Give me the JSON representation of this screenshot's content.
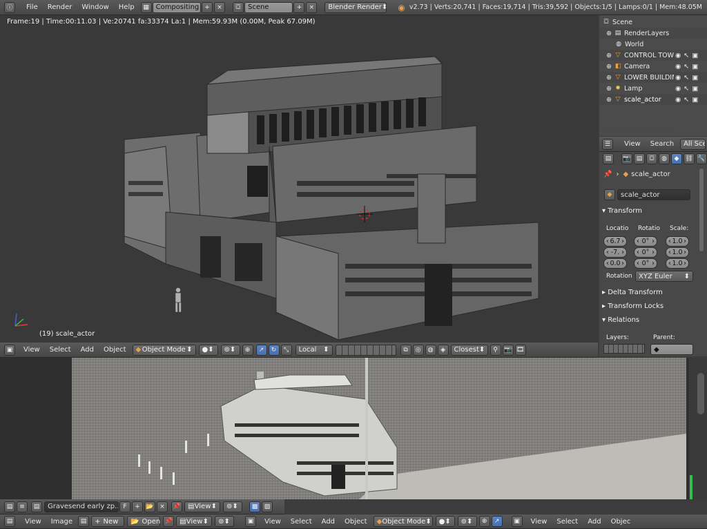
{
  "top_bar": {
    "menus": [
      "File",
      "Render",
      "Window",
      "Help"
    ],
    "screen_layout": "Compositing",
    "scene": "Scene",
    "render_engine": "Blender Render",
    "stats": "v2.73 | Verts:20,741 | Faces:19,714 | Tris:39,592 | Objects:1/5 | Lamps:0/1 | Mem:48.05M"
  },
  "viewport": {
    "info": "Frame:19 | Time:00:11.03 | Ve:20741 fa:33374 La:1 | Mem:59.93M (0.00M, Peak 67.09M)",
    "active_object": "(19) scale_actor",
    "header": {
      "menus": [
        "View",
        "Select",
        "Add",
        "Object"
      ],
      "mode": "Object Mode",
      "orientation": "Local",
      "snap_target": "Closest"
    }
  },
  "outliner": {
    "items": [
      {
        "name": "Scene",
        "icon": "scene-icon"
      },
      {
        "name": "RenderLayers",
        "icon": "renderlayers-icon"
      },
      {
        "name": "World",
        "icon": "world-icon"
      },
      {
        "name": "CONTROL TOWER",
        "icon": "mesh-icon"
      },
      {
        "name": "Camera",
        "icon": "camera-icon"
      },
      {
        "name": "LOWER BUILDING",
        "icon": "mesh-icon"
      },
      {
        "name": "Lamp",
        "icon": "lamp-icon"
      },
      {
        "name": "scale_actor",
        "icon": "mesh-icon"
      }
    ],
    "header": {
      "menus": [
        "View",
        "Search"
      ],
      "filter": "All Scenes"
    }
  },
  "properties": {
    "breadcrumb": "scale_actor",
    "object_name": "scale_actor",
    "transform_panel": "Transform",
    "location_label": "Locatio",
    "rotation_label": "Rotatio",
    "scale_label": "Scale:",
    "location": [
      "6.7",
      "-7.",
      "0.0"
    ],
    "rotation": [
      "0°",
      "0°",
      "0°"
    ],
    "scale": [
      "1.0",
      "1.0",
      "1.0"
    ],
    "rotation_mode_label": "Rotation",
    "rotation_mode": "XYZ Euler",
    "delta_transform": "Delta Transform",
    "transform_locks": "Transform Locks",
    "relations": "Relations",
    "layers_label": "Layers:",
    "parent_label": "Parent:"
  },
  "image_editor": {
    "header": {
      "image_name": "Gravesend early zp...",
      "fake_user": "F",
      "view_menu": "View"
    }
  },
  "bottom_bar": {
    "image_menus": [
      "View",
      "Image"
    ],
    "new_label": "New",
    "open_label": "Open",
    "view_label": "View",
    "viewport_menus": [
      "View",
      "Select",
      "Add",
      "Object"
    ],
    "mode": "Object Mode",
    "right_menus": [
      "View",
      "Select",
      "Add",
      "Objec"
    ]
  },
  "colors": {
    "accent_blue": "#4670b3",
    "mesh_orange": "#e8a04a",
    "viewport_bg": "#393939"
  }
}
